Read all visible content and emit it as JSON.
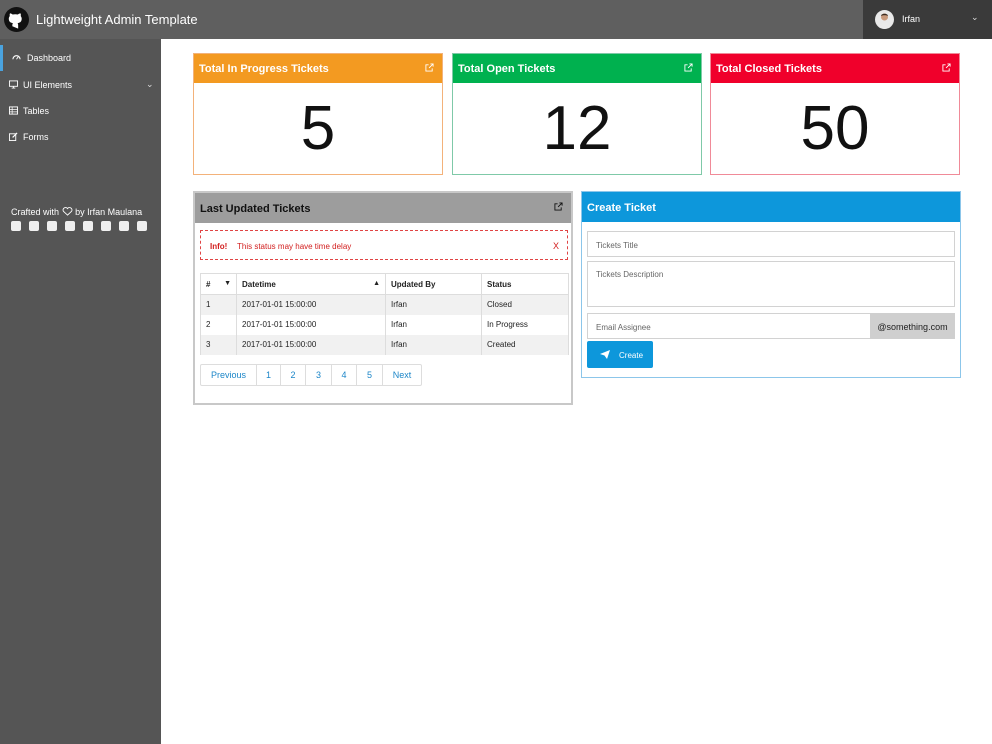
{
  "header": {
    "title": "Lightweight Admin Template",
    "user_name": "Irfan",
    "logo_icon": "github-icon",
    "user_caret_icon": "chevron-down-icon"
  },
  "sidebar": {
    "items": [
      {
        "label": "Dashboard",
        "icon": "dashboard-icon",
        "active": true
      },
      {
        "label": "UI Elements",
        "icon": "monitor-icon",
        "has_submenu": true
      },
      {
        "label": "Tables",
        "icon": "table-icon"
      },
      {
        "label": "Forms",
        "icon": "edit-icon"
      }
    ],
    "crafted_prefix": "Crafted with",
    "crafted_suffix": "by Irfan Maulana",
    "social_icons": [
      "facebook-icon",
      "twitter-icon",
      "instagram-icon",
      "linkedin-icon",
      "bitbucket-icon",
      "github-icon",
      "wordpress-icon",
      "paypal-icon"
    ]
  },
  "stats": [
    {
      "title": "Total In Progress Tickets",
      "value": "5",
      "color": "#f39a21"
    },
    {
      "title": "Total Open Tickets",
      "value": "12",
      "color": "#00b14f"
    },
    {
      "title": "Total Closed Tickets",
      "value": "50",
      "color": "#f0002b"
    }
  ],
  "tickets_panel": {
    "title": "Last Updated Tickets",
    "info_label": "Info!",
    "info_text": "This status may have time delay",
    "info_close": "X",
    "columns": [
      "#",
      "Datetime",
      "Updated By",
      "Status"
    ],
    "rows": [
      {
        "no": "1",
        "datetime": "2017-01-01 15:00:00",
        "updated_by": "Irfan",
        "status": "Closed"
      },
      {
        "no": "2",
        "datetime": "2017-01-01 15:00:00",
        "updated_by": "Irfan",
        "status": "In Progress"
      },
      {
        "no": "3",
        "datetime": "2017-01-01 15:00:00",
        "updated_by": "Irfan",
        "status": "Created"
      }
    ],
    "pagination": {
      "previous": "Previous",
      "pages": [
        "1",
        "2",
        "3",
        "4",
        "5"
      ],
      "next": "Next"
    }
  },
  "create_panel": {
    "title": "Create Ticket",
    "title_placeholder": "Tickets Title",
    "description_placeholder": "Tickets Description",
    "email_placeholder": "Email Assignee",
    "email_domain": "@something.com",
    "button_label": "Create"
  }
}
